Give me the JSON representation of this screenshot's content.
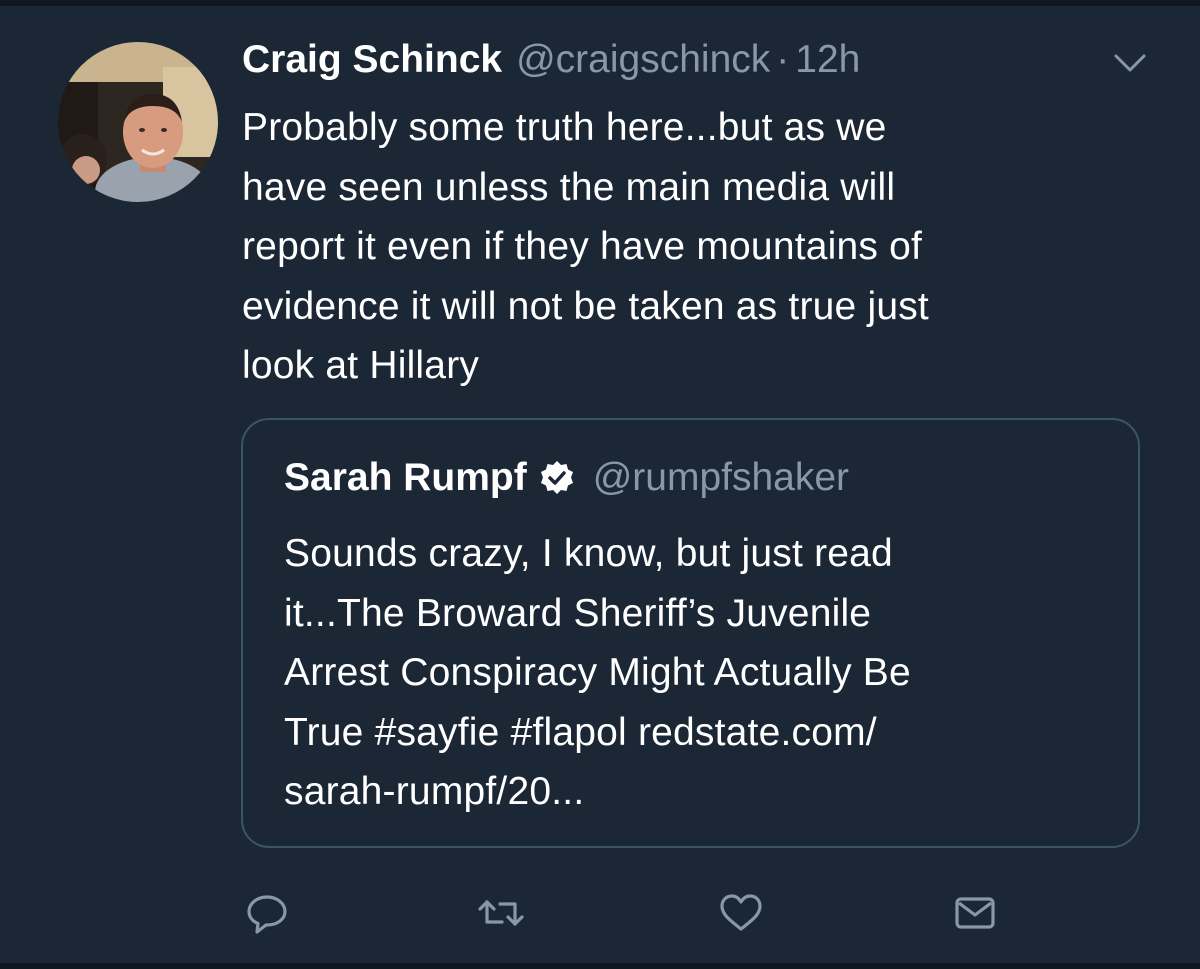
{
  "tweet": {
    "author": {
      "display_name": "Craig Schinck",
      "handle": "@craigschinck",
      "avatar_icon": "user-avatar"
    },
    "separator": "·",
    "time": "12h",
    "text_lines": [
      "Probably some truth here...but as we",
      "have seen unless the main media will",
      "report it even if they have mountains of",
      "evidence it will not be taken as true just",
      "look at Hillary"
    ]
  },
  "quoted_tweet": {
    "display_name": "Sarah Rumpf",
    "verified": true,
    "handle": "@rumpfshaker",
    "text_lines": [
      "Sounds crazy, I know, but just read",
      "it...The Broward Sheriff’s Juvenile",
      "Arrest Conspiracy Might Actually Be",
      "True #sayfie #flapol redstate.com/",
      "sarah-rumpf/20..."
    ]
  },
  "actions": [
    {
      "name": "reply",
      "icon": "reply-icon"
    },
    {
      "name": "retweet",
      "icon": "retweet-icon"
    },
    {
      "name": "like",
      "icon": "heart-icon"
    },
    {
      "name": "share",
      "icon": "mail-icon"
    }
  ],
  "colors": {
    "background": "#1b2735",
    "divider": "#10171e",
    "text_primary": "#ffffff",
    "text_secondary": "#8899a6",
    "quote_border": "#3d5466"
  }
}
